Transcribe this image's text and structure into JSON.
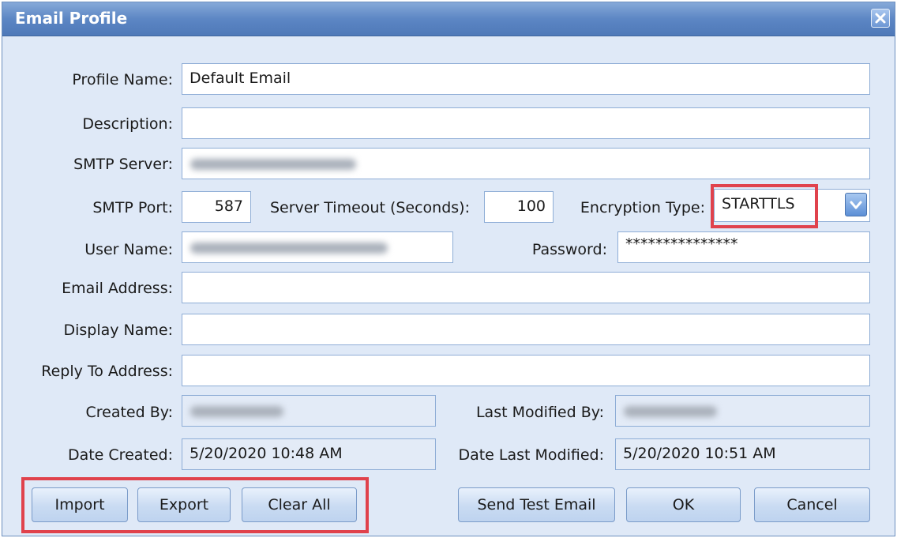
{
  "window": {
    "title": "Email Profile"
  },
  "form": {
    "profile_name": {
      "label": "Profile Name:",
      "value": "Default Email"
    },
    "description": {
      "label": "Description:",
      "value": ""
    },
    "smtp_server": {
      "label": "SMTP Server:"
    },
    "smtp_port": {
      "label": "SMTP Port:",
      "value": "587"
    },
    "server_timeout": {
      "label": "Server Timeout (Seconds):",
      "value": "100"
    },
    "encryption_type": {
      "label": "Encryption Type:",
      "value": "STARTTLS"
    },
    "user_name": {
      "label": "User Name:"
    },
    "password": {
      "label": "Password:",
      "value": "***************"
    },
    "email_address": {
      "label": "Email Address:",
      "value": ""
    },
    "display_name": {
      "label": "Display Name:",
      "value": ""
    },
    "reply_to": {
      "label": "Reply To Address:",
      "value": ""
    },
    "created_by": {
      "label": "Created By:"
    },
    "last_modified_by": {
      "label": "Last Modified By:"
    },
    "date_created": {
      "label": "Date Created:",
      "value": "5/20/2020 10:48 AM"
    },
    "date_last_modified": {
      "label": "Date Last Modified:",
      "value": "5/20/2020 10:51 AM"
    }
  },
  "buttons": {
    "import": "Import",
    "export": "Export",
    "clear_all": "Clear All",
    "send_test_email": "Send Test Email",
    "ok": "OK",
    "cancel": "Cancel"
  },
  "icons": {
    "close": "close-icon",
    "dropdown": "chevron-down-icon"
  },
  "colors": {
    "highlight": "#e0424c",
    "title_bar": "#5c86c4",
    "dialog_bg": "#dfe9f7"
  }
}
